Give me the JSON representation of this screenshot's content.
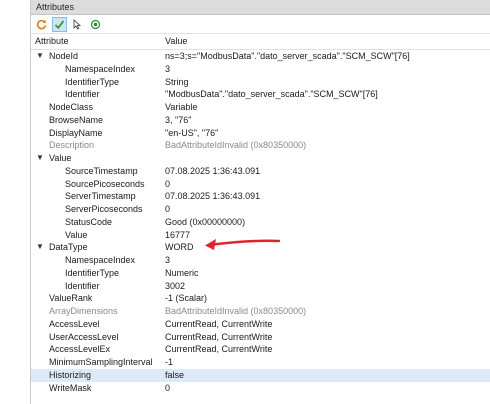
{
  "panel": {
    "title": "Attributes"
  },
  "toolbar": {
    "buttons": [
      "refresh-icon",
      "checkmark-icon",
      "cursor-icon",
      "radio-target-icon"
    ]
  },
  "columns": {
    "attribute": "Attribute",
    "value": "Value"
  },
  "rows": [
    {
      "name": "NodeId",
      "value": "ns=3;s=\"ModbusData\".\"dato_server_scada\".\"SCM_SCW\"[76]",
      "level": 0,
      "expander": "▼"
    },
    {
      "name": "NamespaceIndex",
      "value": "3",
      "level": 2
    },
    {
      "name": "IdentifierType",
      "value": "String",
      "level": 2
    },
    {
      "name": "Identifier",
      "value": "\"ModbusData\".\"dato_server_scada\".\"SCM_SCW\"[76]",
      "level": 2
    },
    {
      "name": "NodeClass",
      "value": "Variable",
      "level": 1
    },
    {
      "name": "BrowseName",
      "value": "3, \"76\"",
      "level": 1
    },
    {
      "name": "DisplayName",
      "value": "\"en-US\", \"76\"",
      "level": 1
    },
    {
      "name": "Description",
      "value": "BadAttributeIdInvalid (0x80350000)",
      "level": 1,
      "disabled": true
    },
    {
      "name": "Value",
      "value": "",
      "level": 0,
      "expander": "▼"
    },
    {
      "name": "SourceTimestamp",
      "value": "07.08.2025 1:36:43.091",
      "level": 2
    },
    {
      "name": "SourcePicoseconds",
      "value": "0",
      "level": 2
    },
    {
      "name": "ServerTimestamp",
      "value": "07.08.2025 1:36:43.091",
      "level": 2
    },
    {
      "name": "ServerPicoseconds",
      "value": "0",
      "level": 2
    },
    {
      "name": "StatusCode",
      "value": "Good (0x00000000)",
      "level": 2
    },
    {
      "name": "Value",
      "value": "16777",
      "level": 2
    },
    {
      "name": "DataType",
      "value": "WORD",
      "level": 0,
      "expander": "▼"
    },
    {
      "name": "NamespaceIndex",
      "value": "3",
      "level": 2
    },
    {
      "name": "IdentifierType",
      "value": "Numeric",
      "level": 2
    },
    {
      "name": "Identifier",
      "value": "3002",
      "level": 2
    },
    {
      "name": "ValueRank",
      "value": "-1 (Scalar)",
      "level": 1
    },
    {
      "name": "ArrayDimensions",
      "value": "BadAttributeIdInvalid (0x80350000)",
      "level": 1,
      "disabled": true
    },
    {
      "name": "AccessLevel",
      "value": "CurrentRead, CurrentWrite",
      "level": 1
    },
    {
      "name": "UserAccessLevel",
      "value": "CurrentRead, CurrentWrite",
      "level": 1
    },
    {
      "name": "AccessLevelEx",
      "value": "CurrentRead, CurrentWrite",
      "level": 1
    },
    {
      "name": "MinimumSamplingInterval",
      "value": "-1",
      "level": 1
    },
    {
      "name": "Historizing",
      "value": "false",
      "level": 1,
      "selected": true
    },
    {
      "name": "WriteMask",
      "value": "0",
      "level": 1
    }
  ],
  "colors": {
    "accent_selection": "#dceaf8",
    "annotation_arrow": "#e0242b",
    "disabled_text": "#8a8a8a"
  }
}
